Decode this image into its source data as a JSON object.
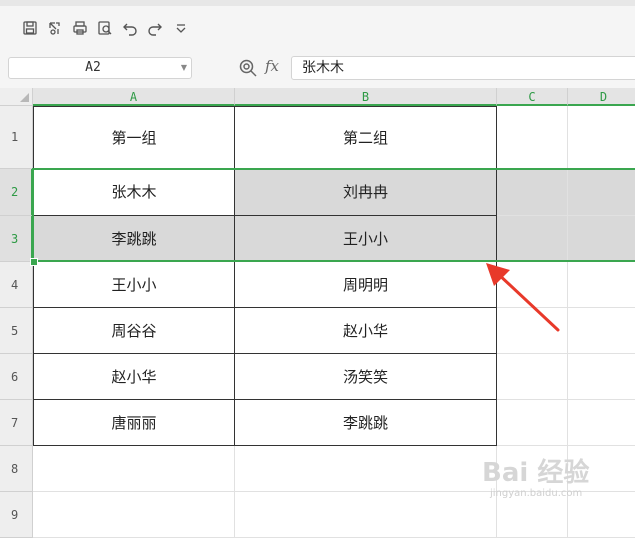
{
  "toolbar": {
    "icons": [
      "save-icon",
      "share-icon",
      "print-icon",
      "print-preview-icon",
      "undo-icon",
      "redo-icon",
      "customize-dropdown-icon"
    ]
  },
  "formula_bar": {
    "name_box": "A2",
    "fx_label": "fx",
    "formula": "张木木"
  },
  "sheet": {
    "columns": [
      "A",
      "B",
      "C",
      "D"
    ],
    "rows": [
      "1",
      "2",
      "3",
      "4",
      "5",
      "6",
      "7",
      "8",
      "9"
    ],
    "cells": {
      "A1": "第一组",
      "B1": "第二组",
      "A2": "张木木",
      "B2": "刘冉冉",
      "A3": "李跳跳",
      "B3": "王小小",
      "A4": "王小小",
      "B4": "周明明",
      "A5": "周谷谷",
      "B5": "赵小华",
      "A6": "赵小华",
      "B6": "汤笑笑",
      "A7": "唐丽丽",
      "B7": "李跳跳"
    },
    "selected_range": "A2:D3",
    "selection_color": "#3aa64f",
    "highlight_color": "#d9d9d9"
  },
  "watermark": {
    "text": "Bai 经验",
    "sub": "jingyan.baidu.com"
  }
}
